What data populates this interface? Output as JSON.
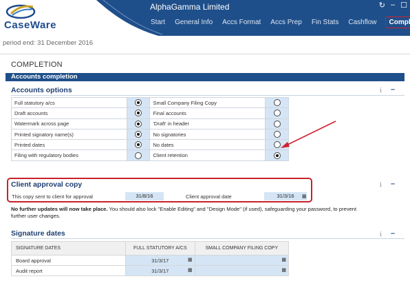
{
  "app": {
    "logo_text": "CaseWare",
    "client_name": "AlphaGamma Limited",
    "window_buttons": [
      "↻",
      "–",
      "☐"
    ]
  },
  "nav": {
    "items": [
      "Start",
      "General Info",
      "Accs Format",
      "Accs Prep",
      "Fin Stats",
      "Cashflow",
      "Completion"
    ],
    "active": "Completion"
  },
  "period": "period end: 31 December 2016",
  "page_title": "COMPLETION",
  "section_bar": "Accounts completion",
  "accounts_options": {
    "heading": "Accounts options",
    "rows": [
      {
        "left": "Full statutory a/cs",
        "left_on": true,
        "right": "Small Company Filing Copy",
        "right_on": false
      },
      {
        "left": "Draft accounts",
        "left_on": true,
        "right": "Final accounts",
        "right_on": false
      },
      {
        "left": "Watermark across page",
        "left_on": true,
        "right": "'Draft' in header",
        "right_on": false
      },
      {
        "left": "Printed signatory name(s)",
        "left_on": true,
        "right": "No signatories",
        "right_on": false
      },
      {
        "left": "Printed dates",
        "left_on": true,
        "right": "No dates",
        "right_on": false
      },
      {
        "left": "Filing with regulatory bodies",
        "left_on": false,
        "right": "Client retention",
        "right_on": true
      }
    ]
  },
  "client_approval": {
    "heading": "Client approval copy",
    "sent_label": "This copy sent to client for approval",
    "sent_value": "31/8/16",
    "date_label": "Client approval date",
    "date_value": "31/3/16"
  },
  "notice": {
    "bold": "No further updates will now take place.",
    "rest": "  You should also lock \"Enable Editing\" and \"Design Mode\" (if used), safeguarding your password, to prevent further user changes."
  },
  "signature_dates": {
    "heading": "Signature dates",
    "columns": [
      "SIGNATURE DATES",
      "FULL STATUTORY A/CS",
      "SMALL COMPANY FILING COPY"
    ],
    "rows": [
      {
        "label": "Board approval",
        "full": "31/3/17",
        "small": ""
      },
      {
        "label": "Audit report",
        "full": "31/3/17",
        "small": ""
      }
    ]
  },
  "icons": {
    "info": "i",
    "collapse": "–",
    "calendar": "▦"
  },
  "colors": {
    "brand_blue": "#1f4f8a",
    "highlight_red": "#c8202a",
    "field_blue": "#d5e5f5"
  }
}
